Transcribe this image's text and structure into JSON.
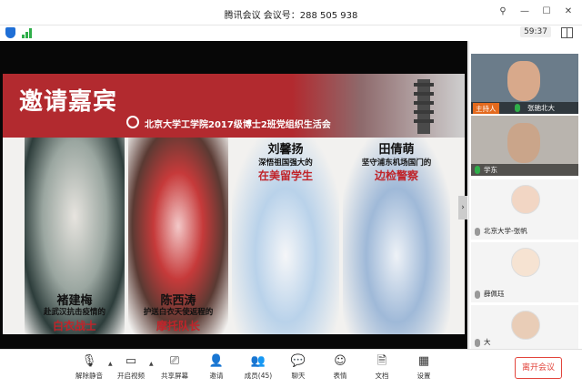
{
  "window": {
    "title": "腾讯会议 会议号：288 505 938",
    "pin_icon": "pin-icon",
    "controls": [
      "minimize-icon",
      "maximize-icon",
      "close-icon"
    ]
  },
  "status": {
    "timer": "59:37",
    "shield_icon": "shield-icon",
    "signal_icon": "signal-icon",
    "layout_icon": "grid-layout-icon"
  },
  "slide": {
    "heading": "邀请嘉宾",
    "subtitle": "北京大学工学院2017级博士2班党组织生活会",
    "guests": [
      {
        "name": "褚建梅",
        "desc": "赴武汉抗击疫情的",
        "tag": "白衣战士"
      },
      {
        "name": "陈西涛",
        "desc": "护送白衣天使返程的",
        "tag": "摩托队长"
      },
      {
        "name": "刘馨扬",
        "desc": "深悟祖国强大的",
        "tag": "在美留学生"
      },
      {
        "name": "田倩萌",
        "desc": "坚守浦东机场国门的",
        "tag": "边检警察"
      }
    ]
  },
  "participants": {
    "host_badge": "主持人",
    "tiles": [
      {
        "name": "张驰北大",
        "kind": "video"
      },
      {
        "name": "学东",
        "kind": "video"
      },
      {
        "name": "北京大学-张帆",
        "kind": "avatar"
      },
      {
        "name": "薛佩珏",
        "kind": "avatar"
      },
      {
        "name": "大",
        "kind": "avatar"
      }
    ]
  },
  "toolbar": {
    "buttons": [
      {
        "label": "解除静音",
        "icon": "mic-muted-icon"
      },
      {
        "label": "开启视频",
        "icon": "camera-off-icon"
      },
      {
        "label": "共享屏幕",
        "icon": "share-screen-icon"
      },
      {
        "label": "邀请",
        "icon": "invite-icon"
      },
      {
        "label": "成员(45)",
        "icon": "members-icon"
      },
      {
        "label": "聊天",
        "icon": "chat-icon"
      },
      {
        "label": "表情",
        "icon": "emoji-icon"
      },
      {
        "label": "文档",
        "icon": "document-icon"
      },
      {
        "label": "设置",
        "icon": "settings-icon"
      }
    ],
    "leave": "离开会议"
  }
}
